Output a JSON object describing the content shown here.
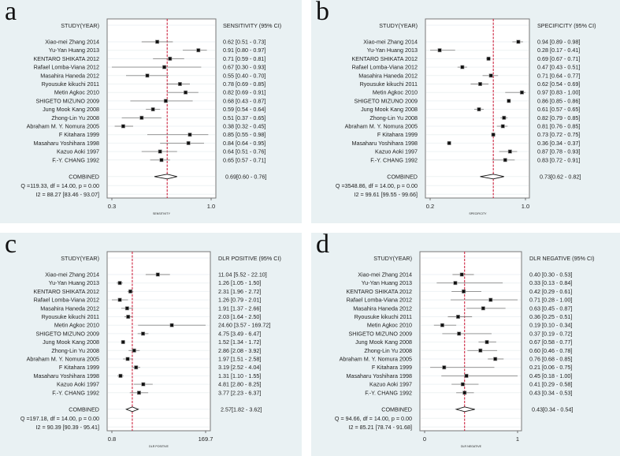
{
  "figure": {
    "studies": [
      "Xiao-mei Zhang 2014",
      "Yu-Yan Huang  2013",
      "KENTARO SHIKATA 2012",
      "Rafael Lomba-Viana 2012",
      "Masahira Haneda 2012",
      "Ryousuke kikuchi 2011",
      "Metin Agkoc 2010",
      "SHIGETO MIZUNO 2009",
      "Jung Mook Kang 2008",
      "Zhong-Lin Yu 2008",
      "Abraham M. Y. Nomura 2005",
      "F Kitahara 1999",
      "Masaharu Yoshihara 1998",
      "Kazuo Aoki 1997",
      "F.-Y. CHANG 1992"
    ],
    "study_header": "STUDY(YEAR)",
    "combined_label": "COMBINED"
  },
  "chart_data": [
    {
      "panel": "a",
      "type": "forest",
      "title": "",
      "column_header": "SENSITIVITY (95% CI)",
      "xlabel": "SENSITIVITY",
      "scale": "linear",
      "xlim": [
        0.3,
        1.0
      ],
      "tick_labels": [
        "0.3",
        "1.0"
      ],
      "ticks": [
        0.3,
        1.0
      ],
      "reference_line": 0.69,
      "estimates": [
        0.62,
        0.91,
        0.71,
        0.67,
        0.55,
        0.78,
        0.82,
        0.68,
        0.59,
        0.51,
        0.38,
        0.85,
        0.84,
        0.64,
        0.65
      ],
      "lower": [
        0.51,
        0.8,
        0.59,
        0.3,
        0.4,
        0.69,
        0.69,
        0.43,
        0.54,
        0.37,
        0.32,
        0.55,
        0.64,
        0.51,
        0.57
      ],
      "upper": [
        0.73,
        0.97,
        0.81,
        0.93,
        0.7,
        0.85,
        0.91,
        0.87,
        0.64,
        0.65,
        0.45,
        0.98,
        0.95,
        0.76,
        0.71
      ],
      "labels": [
        "0.62 [0.51 - 0.73]",
        "0.91 [0.80 - 0.97]",
        "0.71 [0.59 - 0.81]",
        "0.67 [0.30 - 0.93]",
        "0.55 [0.40 - 0.70]",
        "0.78 [0.69 - 0.85]",
        "0.82 [0.69 - 0.91]",
        "0.68 [0.43 - 0.87]",
        "0.59 [0.54 - 0.64]",
        "0.51 [0.37 - 0.65]",
        "0.38 [0.32 - 0.45]",
        "0.85 [0.55 - 0.98]",
        "0.84 [0.64 - 0.95]",
        "0.64 [0.51 - 0.76]",
        "0.65 [0.57 - 0.71]"
      ],
      "combined": {
        "estimate": 0.69,
        "lower": 0.6,
        "upper": 0.76,
        "label": "0.69[0.60 - 0.76]"
      },
      "heterogeneity_q": "Q =119.33, df = 14.00, p =  0.00",
      "heterogeneity_i2": "I2 = 88.27 [83.46 - 93.07]"
    },
    {
      "panel": "b",
      "type": "forest",
      "title": "",
      "column_header": "SPECIFICITY (95% CI)",
      "xlabel": "SPECIFICITY",
      "scale": "linear",
      "xlim": [
        0.2,
        1.0
      ],
      "tick_labels": [
        "0.2",
        "1.0"
      ],
      "ticks": [
        0.2,
        1.0
      ],
      "reference_line": 0.73,
      "estimates": [
        0.94,
        0.28,
        0.69,
        0.47,
        0.71,
        0.62,
        0.97,
        0.86,
        0.61,
        0.82,
        0.81,
        0.73,
        0.36,
        0.87,
        0.83
      ],
      "lower": [
        0.89,
        0.17,
        0.67,
        0.43,
        0.64,
        0.54,
        0.83,
        0.85,
        0.57,
        0.79,
        0.76,
        0.72,
        0.34,
        0.78,
        0.72
      ],
      "upper": [
        0.98,
        0.41,
        0.71,
        0.51,
        0.77,
        0.69,
        1.0,
        0.86,
        0.65,
        0.85,
        0.85,
        0.75,
        0.37,
        0.93,
        0.91
      ],
      "labels": [
        "0.94 [0.89 - 0.98]",
        "0.28 [0.17 - 0.41]",
        "0.69 [0.67 - 0.71]",
        "0.47 [0.43 - 0.51]",
        "0.71 [0.64 - 0.77]",
        "0.62 [0.54 - 0.69]",
        "0.97 [0.83 - 1.00]",
        "0.86 [0.85 - 0.86]",
        "0.61 [0.57 - 0.65]",
        "0.82 [0.79 - 0.85]",
        "0.81 [0.76 - 0.85]",
        "0.73 [0.72 - 0.75]",
        "0.36 [0.34 - 0.37]",
        "0.87 [0.78 - 0.93]",
        "0.83 [0.72 - 0.91]"
      ],
      "combined": {
        "estimate": 0.73,
        "lower": 0.62,
        "upper": 0.82,
        "label": "0.73[0.62 - 0.82]"
      },
      "heterogeneity_q": "Q =3548.86, df = 14.00, p =  0.00",
      "heterogeneity_i2": "I2 = 99.61 [99.55 - 99.66]"
    },
    {
      "panel": "c",
      "type": "forest",
      "title": "",
      "column_header": "DLR POSITIVE (95% CI)",
      "xlabel": "DLR POSITIVE",
      "scale": "log",
      "xlim": [
        0.8,
        169.7
      ],
      "tick_labels": [
        "0.8",
        "169.7"
      ],
      "ticks": [
        0.8,
        169.7
      ],
      "reference_line": 2.57,
      "estimates": [
        11.04,
        1.26,
        2.31,
        1.26,
        1.91,
        2.03,
        24.6,
        4.75,
        1.52,
        2.86,
        1.97,
        3.19,
        1.31,
        4.81,
        3.77
      ],
      "lower": [
        5.52,
        1.05,
        1.96,
        0.79,
        1.37,
        1.64,
        3.57,
        3.49,
        1.34,
        2.08,
        1.51,
        2.52,
        1.1,
        2.8,
        2.23
      ],
      "upper": [
        22.1,
        1.5,
        2.72,
        2.01,
        2.66,
        2.5,
        169.72,
        6.47,
        1.72,
        3.92,
        2.58,
        4.04,
        1.55,
        8.25,
        6.37
      ],
      "labels": [
        "11.04 [5.52 - 22.10]",
        "1.26 [1.05 - 1.50]",
        "2.31 [1.96 - 2.72]",
        "1.26 [0.79 - 2.01]",
        "1.91 [1.37 - 2.66]",
        "2.03 [1.64 - 2.50]",
        "24.60 [3.57 - 169.72]",
        "4.75 [3.49 - 6.47]",
        "1.52 [1.34 - 1.72]",
        "2.86 [2.08 - 3.92]",
        "1.97 [1.51 - 2.58]",
        "3.19 [2.52 - 4.04]",
        "1.31 [1.10 - 1.55]",
        "4.81 [2.80 - 8.25]",
        "3.77 [2.23 - 6.37]"
      ],
      "combined": {
        "estimate": 2.57,
        "lower": 1.82,
        "upper": 3.62,
        "label": "2.57[1.82 - 3.62]"
      },
      "heterogeneity_q": "Q =197.18, df = 14.00, p =  0.00",
      "heterogeneity_i2": "I2 = 90.39 [90.39 - 95.41]"
    },
    {
      "panel": "d",
      "type": "forest",
      "title": "",
      "column_header": "DLR NEGATIVE (95% CI)",
      "xlabel": "DLR NEGATIVE",
      "scale": "linear",
      "xlim": [
        0,
        1
      ],
      "tick_labels": [
        "0",
        "1"
      ],
      "ticks": [
        0,
        1
      ],
      "reference_line": 0.43,
      "estimates": [
        0.4,
        0.33,
        0.42,
        0.71,
        0.63,
        0.36,
        0.19,
        0.37,
        0.67,
        0.6,
        0.76,
        0.21,
        0.45,
        0.41,
        0.43
      ],
      "lower": [
        0.3,
        0.13,
        0.29,
        0.28,
        0.45,
        0.25,
        0.1,
        0.19,
        0.58,
        0.46,
        0.68,
        0.06,
        0.18,
        0.29,
        0.34
      ],
      "upper": [
        0.53,
        0.84,
        0.61,
        1.0,
        0.87,
        0.51,
        0.34,
        0.72,
        0.77,
        0.78,
        0.85,
        0.75,
        1.0,
        0.58,
        0.53
      ],
      "labels": [
        "0.40 [0.30 - 0.53]",
        "0.33 [0.13 - 0.84]",
        "0.42 [0.29 - 0.61]",
        "0.71 [0.28 - 1.00]",
        "0.63 [0.45 - 0.87]",
        "0.36 [0.25 - 0.51]",
        "0.19 [0.10 - 0.34]",
        "0.37 [0.19 - 0.72]",
        "0.67 [0.58 - 0.77]",
        "0.60 [0.46 - 0.78]",
        "0.76 [0.68 - 0.85]",
        "0.21 [0.06 - 0.75]",
        "0.45 [0.18 - 1.00]",
        "0.41 [0.29 - 0.58]",
        "0.43 [0.34 - 0.53]"
      ],
      "combined": {
        "estimate": 0.43,
        "lower": 0.34,
        "upper": 0.54,
        "label": "0.43[0.34 - 0.54]"
      },
      "heterogeneity_q": "Q = 94.66, df = 14.00, p =  0.00",
      "heterogeneity_i2": "I2 = 85.21 [78.74 - 91.68]"
    }
  ],
  "colors": {
    "panel_bg": "#e9f1f3",
    "plot_bg": "#ffffff",
    "reference_line": "#c8102e",
    "marker": "#111111",
    "ci_line": "#888888",
    "row_gridline": "#eef2f4"
  }
}
